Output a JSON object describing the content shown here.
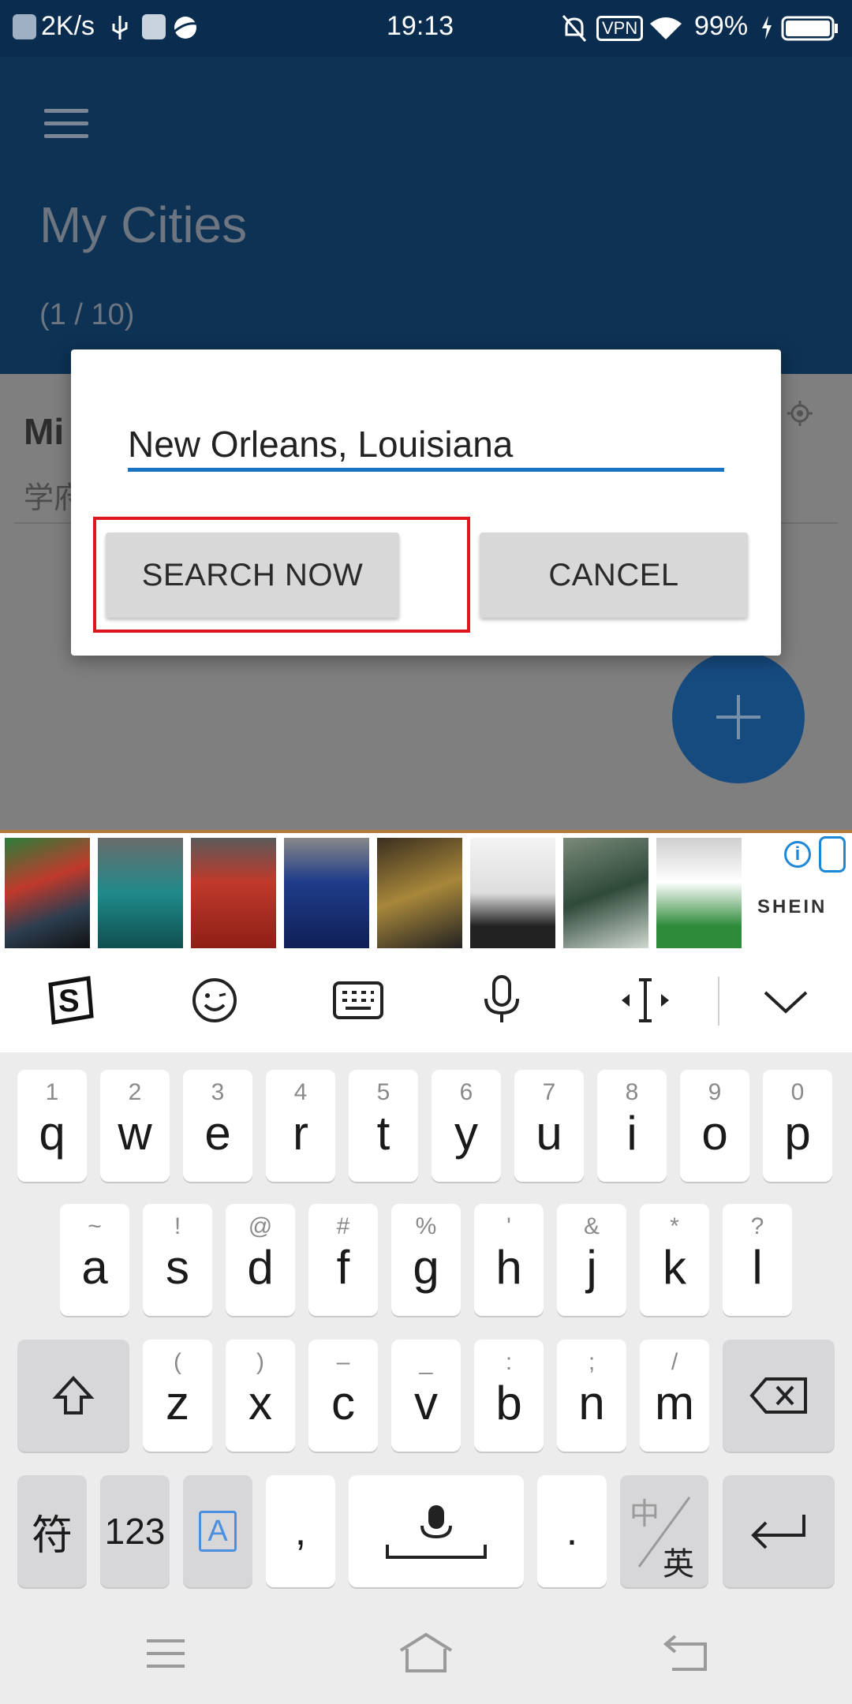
{
  "status_bar": {
    "speed": "2K/s",
    "time": "19:13",
    "vpn": "VPN",
    "battery": "99%"
  },
  "header": {
    "title": "My Cities",
    "count": "(1 / 10)"
  },
  "city_list": {
    "name_partial": "Mi",
    "sub_partial": "学府"
  },
  "dialog": {
    "input_value": "New Orleans, Louisiana",
    "search_label": "SEARCH NOW",
    "cancel_label": "CANCEL"
  },
  "ad": {
    "brand": "SHEIN",
    "info": "i"
  },
  "keyboard": {
    "row1": [
      {
        "hint": "1",
        "key": "q"
      },
      {
        "hint": "2",
        "key": "w"
      },
      {
        "hint": "3",
        "key": "e"
      },
      {
        "hint": "4",
        "key": "r"
      },
      {
        "hint": "5",
        "key": "t"
      },
      {
        "hint": "6",
        "key": "y"
      },
      {
        "hint": "7",
        "key": "u"
      },
      {
        "hint": "8",
        "key": "i"
      },
      {
        "hint": "9",
        "key": "o"
      },
      {
        "hint": "0",
        "key": "p"
      }
    ],
    "row2": [
      {
        "hint": "~",
        "key": "a"
      },
      {
        "hint": "!",
        "key": "s"
      },
      {
        "hint": "@",
        "key": "d"
      },
      {
        "hint": "#",
        "key": "f"
      },
      {
        "hint": "%",
        "key": "g"
      },
      {
        "hint": "'",
        "key": "h"
      },
      {
        "hint": "&",
        "key": "j"
      },
      {
        "hint": "*",
        "key": "k"
      },
      {
        "hint": "?",
        "key": "l"
      }
    ],
    "row3": [
      {
        "hint": "(",
        "key": "z"
      },
      {
        "hint": ")",
        "key": "x"
      },
      {
        "hint": "–",
        "key": "c"
      },
      {
        "hint": "_",
        "key": "v"
      },
      {
        "hint": ":",
        "key": "b"
      },
      {
        "hint": ";",
        "key": "n"
      },
      {
        "hint": "/",
        "key": "m"
      }
    ],
    "symbols": "符",
    "numbers": "123",
    "comma": ",",
    "period": ".",
    "lang_top": "中",
    "lang_bottom": "英",
    "lang_indicator": "A"
  }
}
